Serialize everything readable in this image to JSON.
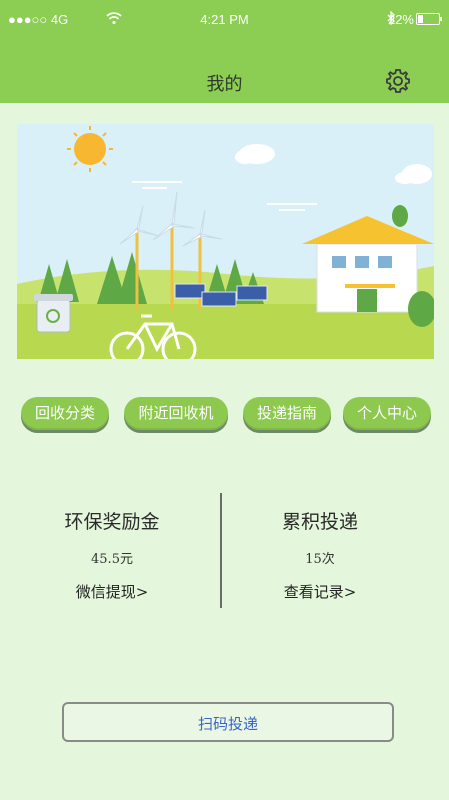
{
  "status_bar": {
    "carrier": "●●●○○ 4G",
    "time": "4:21 PM",
    "battery": "22%"
  },
  "header": {
    "title": "我的"
  },
  "tabs": [
    {
      "label": "回收分类"
    },
    {
      "label": "附近回收机"
    },
    {
      "label": "投递指南"
    },
    {
      "label": "个人中心"
    }
  ],
  "stats": {
    "reward": {
      "title": "环保奖励金",
      "value": "45.5元",
      "link": "微信提现>"
    },
    "deliveries": {
      "title": "累积投递",
      "value": "15次",
      "link": "查看记录>"
    }
  },
  "scan_button": {
    "label": "扫码投递"
  },
  "colors": {
    "header": "#8ccd53",
    "background": "#e4f7dc",
    "tab": "#8cc94e",
    "scan_text": "#3a63c9"
  }
}
